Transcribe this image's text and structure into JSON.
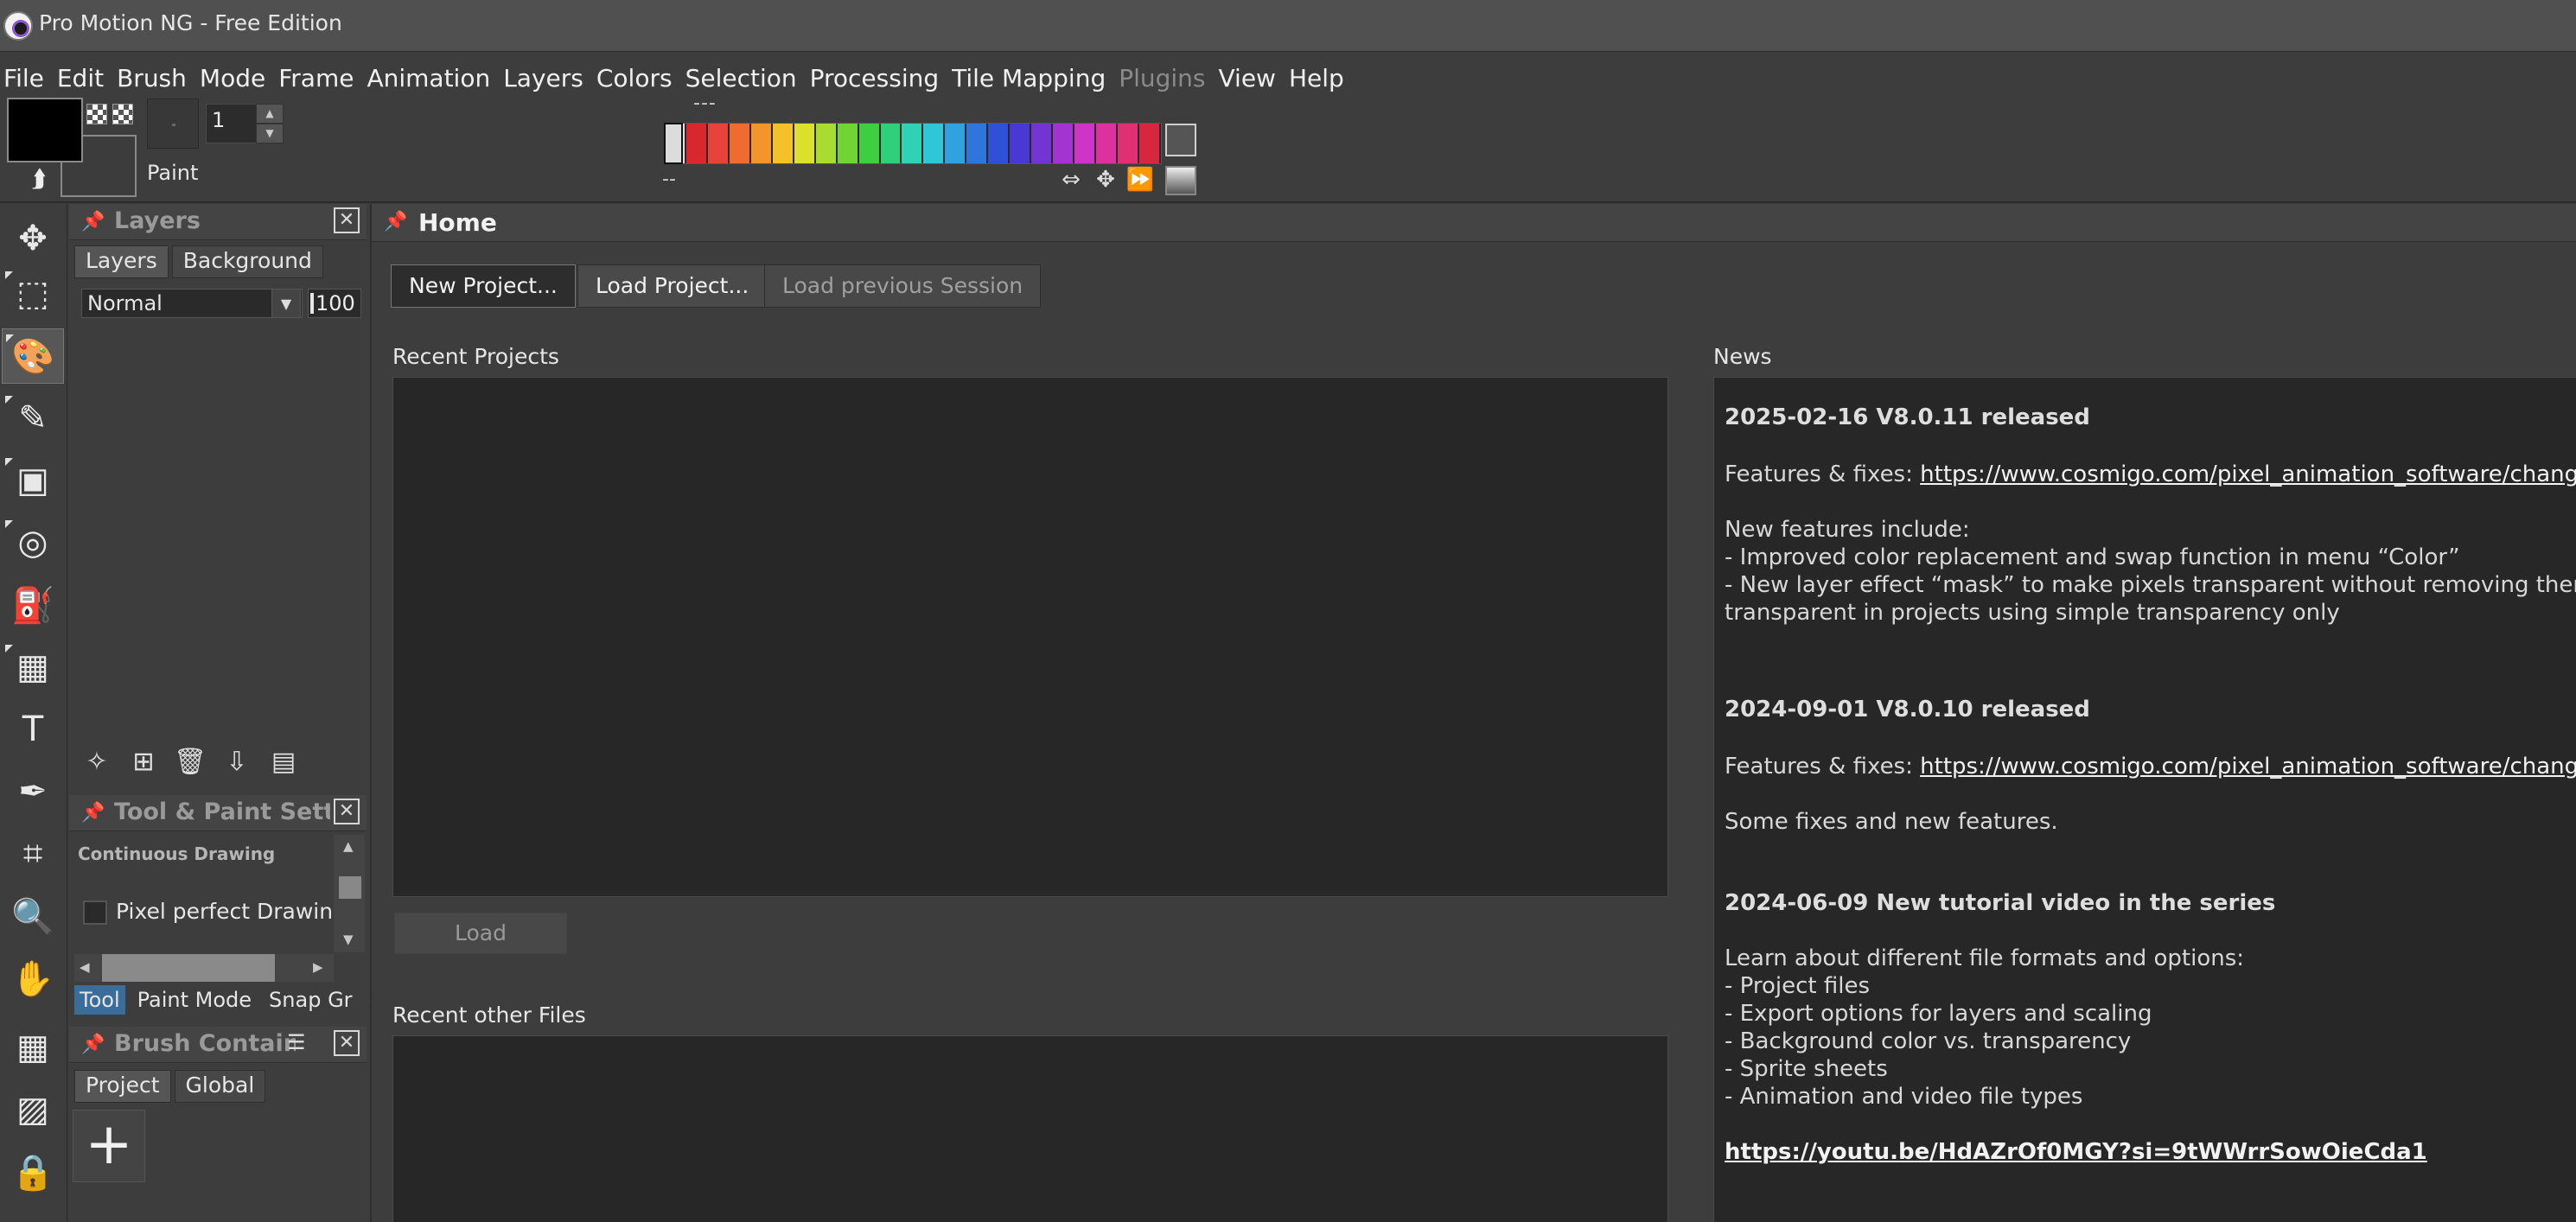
{
  "window": {
    "title": "Pro Motion NG - Free Edition"
  },
  "menu": [
    "File",
    "Edit",
    "Brush",
    "Mode",
    "Frame",
    "Animation",
    "Layers",
    "Colors",
    "Selection",
    "Processing",
    "Tile Mapping",
    "Plugins",
    "View",
    "Help"
  ],
  "menu_disabled": [
    "Plugins"
  ],
  "toolbar": {
    "brush_size": "1",
    "mode_label": "Paint",
    "palette_top_label": "---",
    "palette_bottom_label": "--",
    "primary_color": "#000000",
    "palette_colors": [
      "#e0e0e0",
      "#d9272e",
      "#e8433a",
      "#ef6b2f",
      "#f2962a",
      "#f5c12b",
      "#dbe12c",
      "#a8dc2e",
      "#72d334",
      "#3fce42",
      "#2fcf7b",
      "#2fd2b2",
      "#2fc7d8",
      "#2fa2df",
      "#2f76dc",
      "#3050d6",
      "#4a38d3",
      "#7434d2",
      "#a334cf",
      "#cf34c8",
      "#dd31a0",
      "#e02f73",
      "#d9263f"
    ]
  },
  "toolbox": [
    "move-tool",
    "rect-select-tool",
    "brush-tool",
    "pencil-tool",
    "rectangle-tool",
    "ellipse-tool",
    "fill-tool",
    "tile-tool",
    "text-tool",
    "eyedropper-tool",
    "crop-tool",
    "zoom-tool",
    "hand-tool",
    "grid-tool",
    "reference-tool",
    "lock-tool"
  ],
  "layers_panel": {
    "title": "Layers",
    "tabs": [
      "Layers",
      "Background"
    ],
    "blend_mode": "Normal",
    "opacity": "100"
  },
  "tool_panel": {
    "title": "Tool & Paint Settin",
    "continuous_label": "Continuous Drawing",
    "pixel_perfect_label": "Pixel perfect Drawing",
    "tabs": [
      "Tool",
      "Paint Mode",
      "Snap Gr"
    ]
  },
  "brushes_panel": {
    "title": "Brush Containe",
    "tabs": [
      "Project",
      "Global"
    ],
    "add_label": "+"
  },
  "home": {
    "title": "Home",
    "new_project": "New Project...",
    "load_project": "Load Project...",
    "load_session": "Load previous Session",
    "recent_projects_label": "Recent Projects",
    "load_button": "Load",
    "recent_files_label": "Recent other Files",
    "news_label": "News"
  },
  "news": {
    "h1": "2025-02-16 V8.0.11 released",
    "fixes_prefix": "Features &  fixes: ",
    "changelog_url": "https://www.cosmigo.com/pixel_animation_software/changelog",
    "new_features": "New features include:",
    "feat1": "- Improved color replacement and swap function in menu “Color”",
    "feat2": "- New layer effect “mask” to make pixels transparent without removing them. It also",
    "feat3": "transparent in projects using simple transparency only",
    "h2": "2024-09-01 V8.0.10 released",
    "fixes_prefix2": "Features &  fixes: ",
    "changelog_url2": "https://www.cosmigo.com/pixel_animation_software/changelog",
    "some_fixes": "Some fixes and new features.",
    "h3": "2024-06-09 New tutorial video in the series",
    "learn": "Learn about different file formats and options:",
    "item1": "- Project files",
    "item2": "- Export options for layers and scaling",
    "item3": "- Background color vs. transparency",
    "item4": "- Sprite sheets",
    "item5": "- Animation and video file types",
    "video_url": "https://youtu.be/HdAZrOf0MGY?si=9tWWrrSowOieCda1"
  }
}
